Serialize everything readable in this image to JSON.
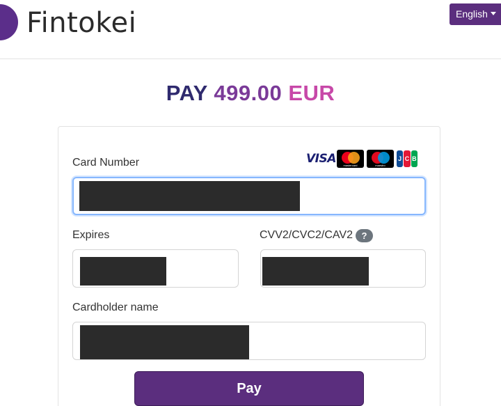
{
  "header": {
    "logo_text": "Fintokei",
    "language_label": "English"
  },
  "payment": {
    "title_word1": "PAY",
    "title_amount": "499.00",
    "title_currency": "EUR"
  },
  "form": {
    "card_number_label": "Card Number",
    "expires_label": "Expires",
    "cvv_label": "CVV2/CVC2/CAV2",
    "cvv_help": "?",
    "cardholder_label": "Cardholder name",
    "pay_button": "Pay"
  },
  "card_brands": {
    "visa": "VISA",
    "mastercard": "mastercard",
    "maestro": "maestro",
    "jcb": [
      "J",
      "C",
      "B"
    ]
  },
  "colors": {
    "brand_purple": "#5b2e7e",
    "title_dark": "#2f2a6e",
    "title_mid": "#7a3a98",
    "title_pink": "#c748a8",
    "focus_border": "#86b7fe"
  }
}
